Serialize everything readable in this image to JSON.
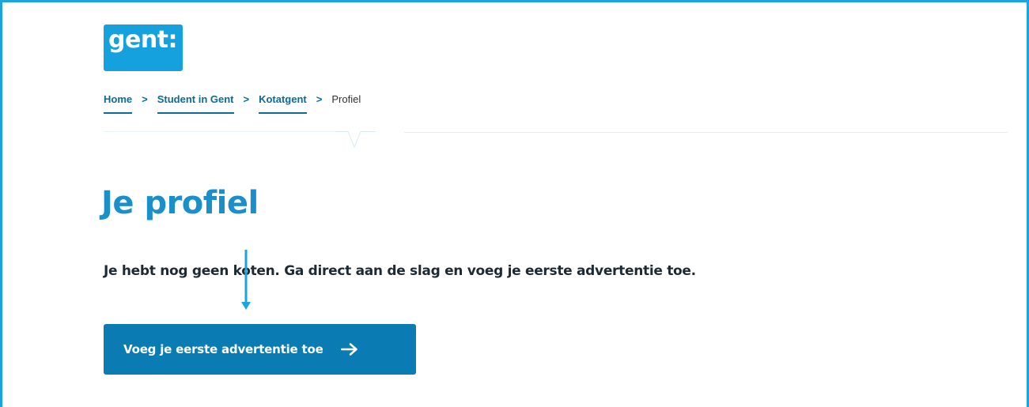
{
  "logo": {
    "text": "gent:",
    "color": "#15a0de"
  },
  "breadcrumb": {
    "items": [
      {
        "label": "Home"
      },
      {
        "label": "Student in Gent"
      },
      {
        "label": "Kotatgent"
      }
    ],
    "separator": ">",
    "current": "Profiel"
  },
  "page": {
    "title": "Je profiel",
    "intro": "Je hebt nog geen koten. Ga direct aan de slag en voeg je eerste advertentie toe."
  },
  "cta": {
    "label": "Voeg je eerste advertentie toe",
    "icon": "arrow-right-icon"
  },
  "colors": {
    "accent": "#1aa5e0",
    "title": "#1a8fc9",
    "button": "#0b7bb3",
    "link": "#0a6b9a"
  }
}
